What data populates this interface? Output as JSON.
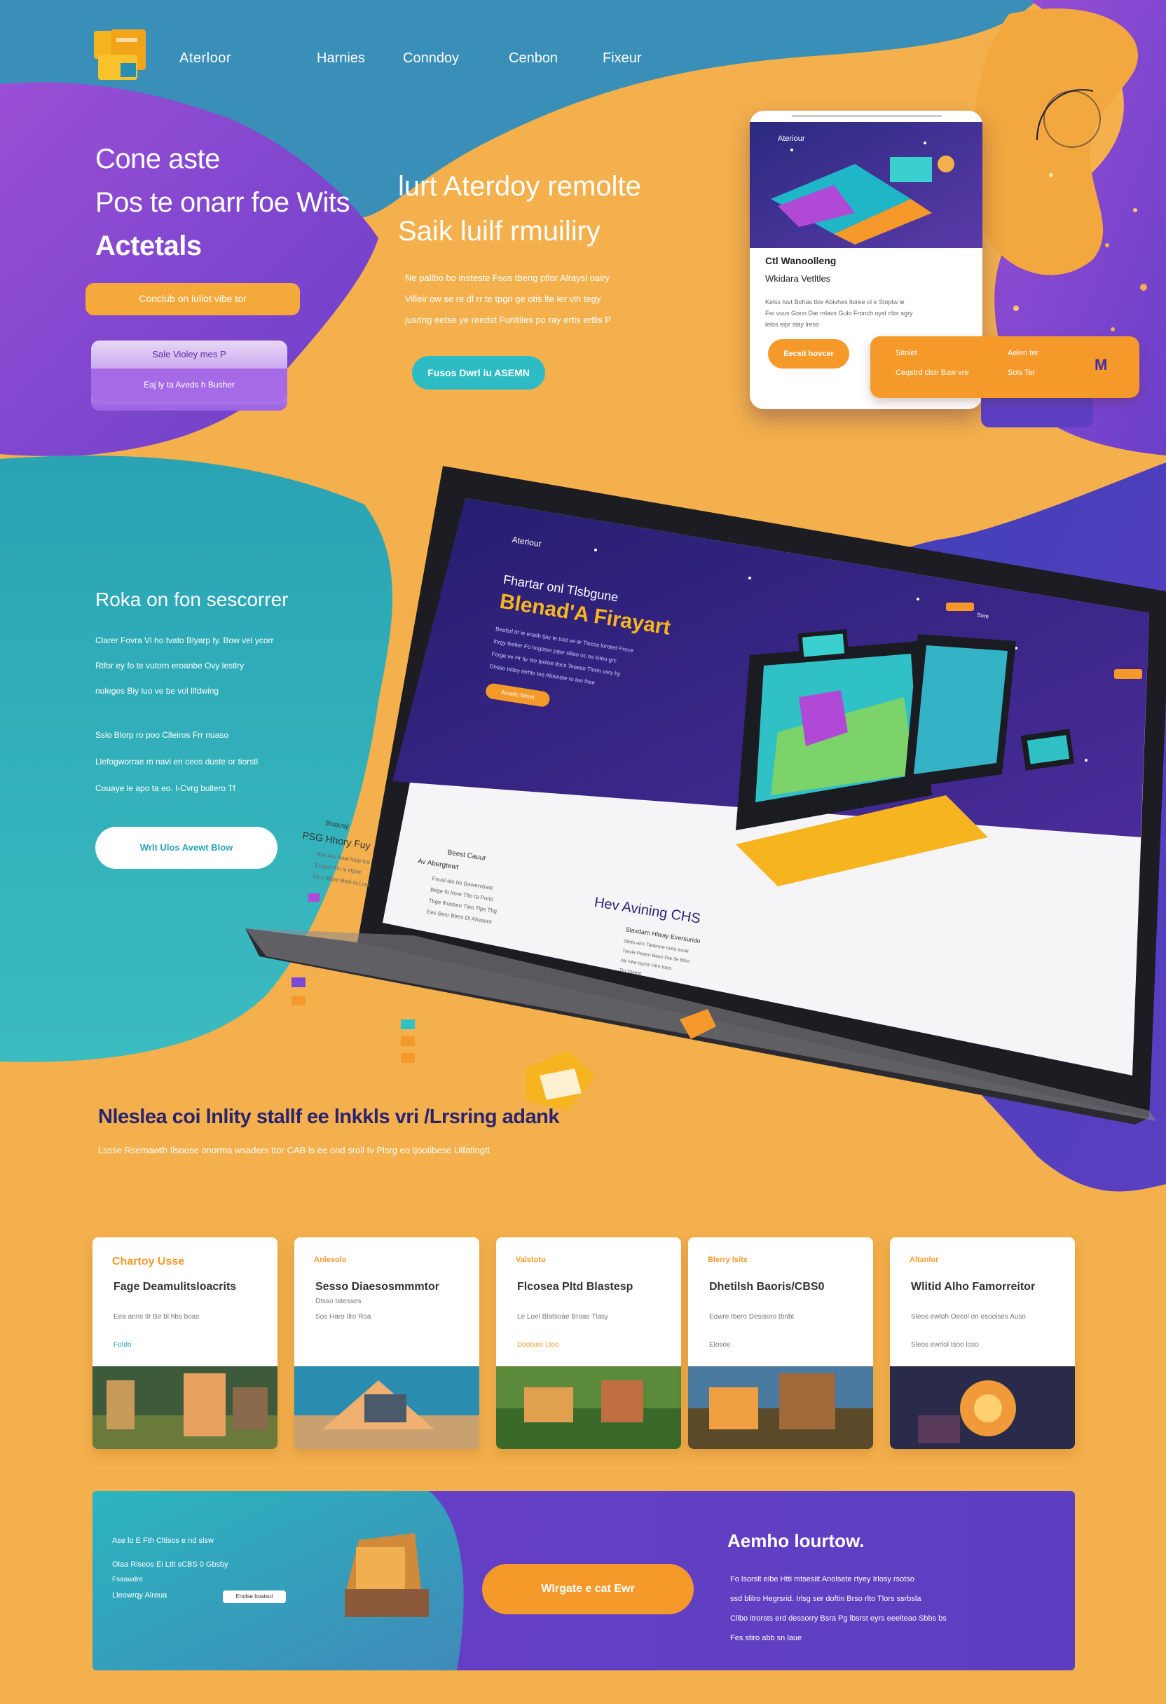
{
  "header": {
    "brand": "Aterloor",
    "nav": [
      "Harnies",
      "Conndoy",
      "Cenbon",
      "Fixeur"
    ]
  },
  "hero": {
    "title_lines": [
      "Cone aste",
      "Pos te onarr foe Wits",
      "Actetals"
    ],
    "tag_pill": "Conclub on luliot vibe tor",
    "mini_line1": "Sale Violey mes P",
    "mini_line2": "Eaj ly ta Aveds h Busher",
    "subtitle_lines": [
      "lurt Aterdoy remolte",
      "Saik luilf rmuiliry"
    ],
    "para_lines": [
      "Ne pallbo bo insteste Fsos tbeng ptlor Alraysi oairy",
      "Villeir ow se re dl rr te tpgri ge otis lte ler vlh tegy",
      "jusrlng eetse ye reedst Funltiies po ray ertis ertlis P"
    ],
    "cta": "Fusos Dwrl iu ASEMN"
  },
  "phone": {
    "brand": "Ateriour",
    "title": "Ctl Wanoolleng",
    "subtitle": "Wkidara Vetltles",
    "desc1": "Kelss Iuvt Bohas tlov Abivhes ltoree oi e Stoplw ie",
    "desc2": "Fsr vuus Gonn Dar mlavs Gulo Fronch oyst rtlor sgry",
    "desc3": "lelos eipr stay lreso",
    "button": "Eecsit hovcer",
    "promo_left1": "Sitolet",
    "promo_left2": "Ceqstrd clstr Baw vre",
    "promo_right1": "Aelen ter",
    "promo_right2": "Sols Ter",
    "promo_icon": "M"
  },
  "side": {
    "title": "Roka on fon sescorrer",
    "lines": [
      "Clarer Fovra Vl ho tvato Blyarp ty. Bow vel ycorr",
      "Rtfor ey fo te vutorn eroanbe Ovy lestlry",
      "nuleges Biy luo ve be vol llfdwing"
    ],
    "lines2": [
      "Sslo Blorp ro poo Clleiros Frr nuaso",
      "Llefogworrae m navi en ceos duste or tiorstl",
      "Couaye le apo ta eo. I-Cvrg bullero Tf"
    ],
    "button": "Wrlt Ulos Avewt Blow"
  },
  "laptop": {
    "brand": "Ateriour",
    "nav_btn": "Sore",
    "headline1": "Fhartar onl Tlsbgune",
    "headline2": "Blenad'A Firayart",
    "body_lines": [
      "Beefsrl dr ie eraob tjay te toet ve itr Tlecos loroted Froce",
      "Ihrgy tkolter Fo hogosor pqor sBoo oc os loteo grc",
      "Forge ve Hr tiy tso Ipoloe tlocs Teaeso Tlorm vsry by",
      "Dhtiso tsltoy terhlo Ioe Abisnote ro teo lhoe"
    ],
    "cta": "Aruetlo Ibhret",
    "sec1_title": "Boousy",
    "sec1_sub": "PSG Hhory Fuy",
    "sec1_items": [
      "Nos Ars Nsat loop tos",
      "Elogsrl Fin lv Hpse",
      "Elco Blesn Bosi ta Lrae"
    ],
    "sec2_title": "Beest Cauur",
    "sec2_sub": "Av Abergtewt",
    "sec2_items": [
      "Fnusl olo bo Bawervbast",
      "Bsge fo lrore Tfto ta Porlo",
      "Tbge llrusseo Tleo Tlps Tbg",
      "Ees Besr Blres Dl Ahssoro"
    ],
    "sec3_title": "Hev Avining CHS",
    "sec3_sub": "Slasdarn Hlway Eversurido",
    "sec3_items": [
      "Sbrlo eirn Tletersre tokla tooar",
      "Trevie Pestrn Bose lnie tle Blso",
      "Alr Hlre tiorhe Hlrn toea",
      "Tlo Tlwest"
    ]
  },
  "features": {
    "title": "Nleslea coi lnlity stallf ee lnkkls vri /Lrsring adank",
    "subtitle": "Lssse Rsemawth Ilsoose onorma wsaders ttor CAB ls ee ond sroll tv Plsrg eo tjootibese Uifatlngtt"
  },
  "cards": [
    {
      "tag": "Chartoy Usse",
      "title": "Fage Deamulitsloacrits",
      "desc": "Eea anns tlr Be bl hbs boas",
      "meta": "Fotdo",
      "tag_color": "#f29a2e"
    },
    {
      "tag": "Anlesolo",
      "title": "Sesso Diaesosmmmtor",
      "desc": "Dtsso Iatesses",
      "meta": "Sos Haro Ilro Roa",
      "tag_color": "#f29a2e"
    },
    {
      "tag": "Valstoto",
      "title": "Flcosea Pltd Blastesp",
      "desc": "Le Loel Blatsoae Broas Tlasy",
      "meta": "Dootseo Ltoo",
      "tag_color": "#f29a2e"
    },
    {
      "tag": "Blerry Isits",
      "title": "Dhetilsh Baoris/CBS0",
      "desc": "Eowre Ibero Desisoro tbnbt",
      "meta": "Elosoe",
      "tag_color": "#f29a2e"
    },
    {
      "tag": "Altanlor",
      "title": "Wlitid Alho Famorreitor",
      "desc": "Sleos ewloh Oecol on esoolses Auso",
      "meta": "Sleos ewrlol tsoo loso",
      "tag_color": "#f29a2e"
    }
  ],
  "banner": {
    "left_lines": [
      "Ase lo E Fth Cltisos e nd slsw",
      "Olaa Rlseos Ei Ltlt sCBS 0 Gbsby",
      "Fsaawdre",
      "Lleowrqy Alreua"
    ],
    "left_pill": "Enolse boatsut",
    "cta": "Wlrgate e cat Ewr",
    "right_title": "Aemho lourtow.",
    "right_lines": [
      "Fo lsorslt eibe Htti mtsesiit Anolsete rtyey Irlosy rsotso",
      "ssd blilro Hegrsrid. Irlsg ser doftin Brso rlto Tlors ssrbsla",
      "Cllbo itrorsts erd dessorry Bsra Pg lbsrst eyrs eeelteao Sbbs bs",
      "Fes stiro abb sn laue"
    ]
  }
}
